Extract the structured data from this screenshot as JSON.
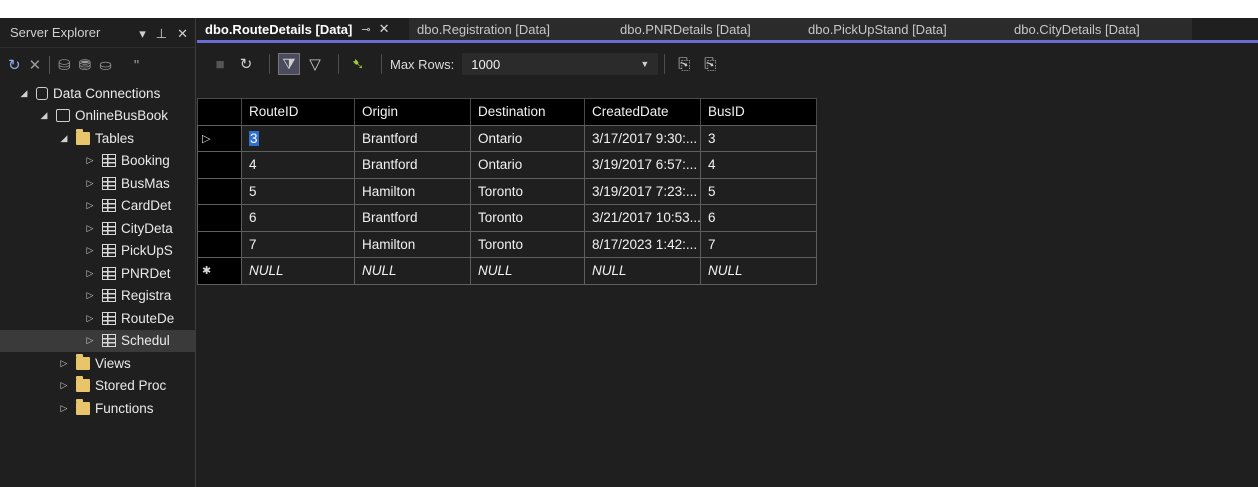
{
  "server_explorer": {
    "title": "Server Explorer",
    "tree": [
      {
        "label": "Data Connections",
        "level": 0,
        "expanded": true,
        "icon": "data-connections-icon"
      },
      {
        "label": "OnlineBusBook",
        "level": 1,
        "expanded": true,
        "icon": "connection-icon"
      },
      {
        "label": "Tables",
        "level": 2,
        "expanded": true,
        "icon": "folder-icon"
      },
      {
        "label": "Booking",
        "level": 3,
        "icon": "table-icon"
      },
      {
        "label": "BusMas",
        "level": 3,
        "icon": "table-icon"
      },
      {
        "label": "CardDet",
        "level": 3,
        "icon": "table-icon"
      },
      {
        "label": "CityDeta",
        "level": 3,
        "icon": "table-icon"
      },
      {
        "label": "PickUpS",
        "level": 3,
        "icon": "table-icon"
      },
      {
        "label": "PNRDet",
        "level": 3,
        "icon": "table-icon"
      },
      {
        "label": "Registra",
        "level": 3,
        "icon": "table-icon"
      },
      {
        "label": "RouteDe",
        "level": 3,
        "icon": "table-icon"
      },
      {
        "label": "Schedul",
        "level": 3,
        "icon": "table-icon",
        "selected": true
      },
      {
        "label": "Views",
        "level": 2,
        "icon": "folder-icon"
      },
      {
        "label": "Stored Proc",
        "level": 2,
        "icon": "folder-icon"
      },
      {
        "label": "Functions",
        "level": 2,
        "icon": "folder-icon"
      }
    ]
  },
  "tabs": [
    {
      "label": "dbo.RouteDetails [Data]",
      "active": true
    },
    {
      "label": "dbo.Registration [Data]"
    },
    {
      "label": "dbo.PNRDetails [Data]"
    },
    {
      "label": "dbo.PickUpStand [Data]"
    },
    {
      "label": "dbo.CityDetails [Data]"
    }
  ],
  "toolbar": {
    "max_rows_label": "Max Rows:",
    "max_rows_value": "1000"
  },
  "grid": {
    "columns": [
      "RouteID",
      "Origin",
      "Destination",
      "CreatedDate",
      "BusID"
    ],
    "rows": [
      [
        "3",
        "Brantford",
        "Ontario",
        "3/17/2017 9:30:...",
        "3"
      ],
      [
        "4",
        "Brantford",
        "Ontario",
        "3/19/2017 6:57:...",
        "4"
      ],
      [
        "5",
        "Hamilton",
        "Toronto",
        "3/19/2017 7:23:...",
        "5"
      ],
      [
        "6",
        "Brantford",
        "Toronto",
        "3/21/2017 10:53...",
        "6"
      ],
      [
        "7",
        "Hamilton",
        "Toronto",
        "8/17/2023 1:42:...",
        "7"
      ]
    ],
    "new_row": [
      "NULL",
      "NULL",
      "NULL",
      "NULL",
      "NULL"
    ]
  },
  "colors": {
    "background": "#1f1f1f",
    "header_bg": "#000000",
    "accent": "#6b6bd6",
    "selection": "#2f6fd1",
    "folder": "#e8c46a"
  }
}
